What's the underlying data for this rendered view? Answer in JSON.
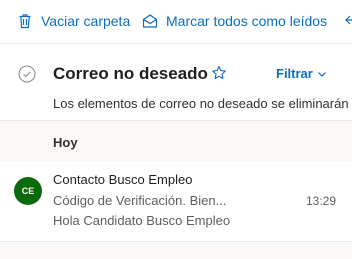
{
  "toolbar": {
    "empty_folder_label": "Vaciar carpeta",
    "mark_all_read_label": "Marcar todos como leídos"
  },
  "folder": {
    "title": "Correo no deseado",
    "filter_label": "Filtrar",
    "info_text": "Los elementos de correo no deseado se eliminarán"
  },
  "group": {
    "label": "Hoy"
  },
  "messages": [
    {
      "avatar_initials": "CE",
      "avatar_color": "#0b6a0b",
      "sender": "Contacto Busco Empleo",
      "subject": "Código de Verificación. Bien...",
      "time": "13:29",
      "preview": "Hola Candidato Busco Empleo"
    }
  ],
  "icons": {
    "empty_folder": "trash-icon",
    "mark_all_read": "envelope-open-icon",
    "overflow": "reply-icon",
    "select_all": "circle-check-icon",
    "favorite": "star-icon",
    "filter_chevron": "chevron-down-icon"
  },
  "colors": {
    "accent": "#0f6cbd",
    "avatar": "#0b6a0b"
  }
}
